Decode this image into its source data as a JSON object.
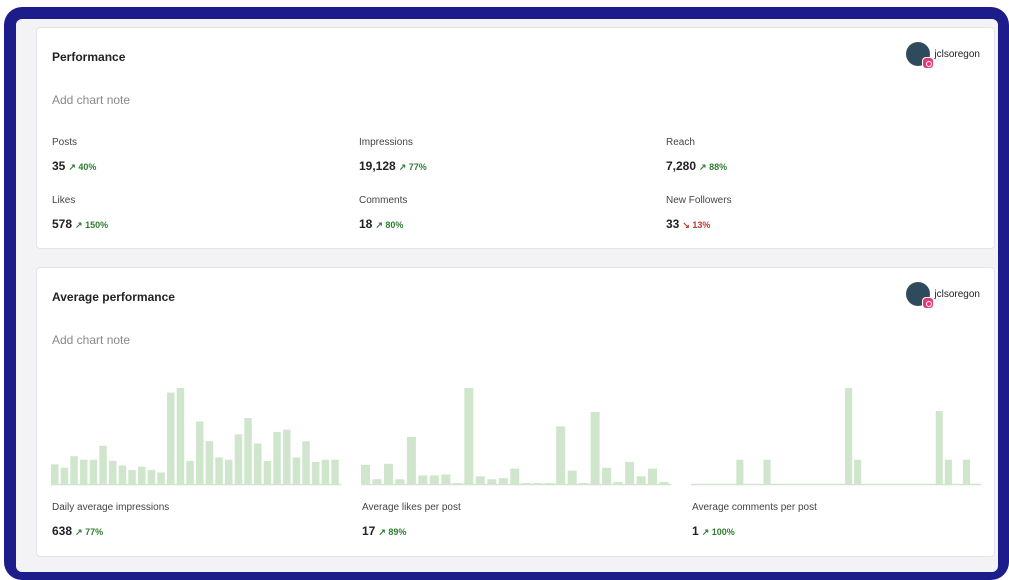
{
  "accent": "#1c1c8a",
  "bar_color": "#cfe6cc",
  "performance": {
    "title": "Performance",
    "note_placeholder": "Add chart note",
    "account": "jclsoregon",
    "metrics": [
      {
        "label": "Posts",
        "value": "35",
        "change": "↗ 40%",
        "dir": "up"
      },
      {
        "label": "Impressions",
        "value": "19,128",
        "change": "↗ 77%",
        "dir": "up"
      },
      {
        "label": "Reach",
        "value": "7,280",
        "change": "↗ 88%",
        "dir": "up"
      },
      {
        "label": "Likes",
        "value": "578",
        "change": "↗ 150%",
        "dir": "up"
      },
      {
        "label": "Comments",
        "value": "18",
        "change": "↗ 80%",
        "dir": "up"
      },
      {
        "label": "New Followers",
        "value": "33",
        "change": "↘ 13%",
        "dir": "down"
      }
    ]
  },
  "average": {
    "title": "Average performance",
    "note_placeholder": "Add chart note",
    "account": "jclsoregon",
    "metrics": [
      {
        "label": "Daily average impressions",
        "value": "638",
        "change": "↗ 77%",
        "dir": "up"
      },
      {
        "label": "Average likes per post",
        "value": "17",
        "change": "↗ 89%",
        "dir": "up"
      },
      {
        "label": "Average comments per post",
        "value": "1",
        "change": "↗ 100%",
        "dir": "up"
      }
    ]
  },
  "chart_data": [
    {
      "type": "bar",
      "title": "Daily average impressions",
      "values": [
        17,
        14,
        24,
        21,
        21,
        33,
        20,
        16,
        12,
        15,
        12,
        10,
        79,
        83,
        20,
        54,
        37,
        23,
        21,
        43,
        57,
        35,
        20,
        45,
        47,
        23,
        37,
        19,
        21,
        21
      ]
    },
    {
      "type": "bar",
      "title": "Average likes per post",
      "values": [
        20,
        5,
        21,
        5,
        49,
        9,
        9,
        10,
        1,
        100,
        8,
        5,
        6,
        16,
        1,
        1,
        1,
        60,
        14,
        1,
        75,
        17,
        2,
        23,
        8,
        16,
        2
      ]
    },
    {
      "type": "bar",
      "title": "Average comments per post",
      "values": [
        0,
        0,
        0,
        0,
        0,
        20,
        0,
        0,
        20,
        0,
        0,
        0,
        0,
        0,
        0,
        0,
        0,
        79,
        20,
        0,
        0,
        0,
        0,
        0,
        0,
        0,
        0,
        60,
        20,
        0,
        20,
        0
      ]
    }
  ]
}
